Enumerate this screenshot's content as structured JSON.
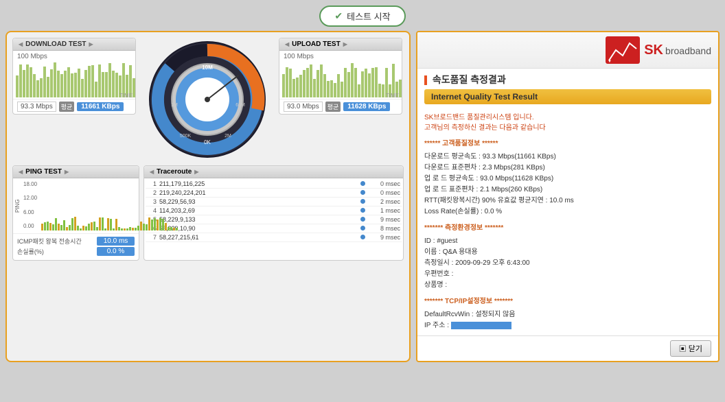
{
  "topButton": {
    "label": "테스트 시작"
  },
  "downloadTest": {
    "sectionLabel": "DOWNLOAD TEST",
    "speedMax": "100 Mbps",
    "timeLabel": "TIME",
    "resultSpeed": "93.3 Mbps",
    "avgLabel": "평균",
    "kbpsValue": "11661 KBps"
  },
  "uploadTest": {
    "sectionLabel": "UPLOAD TEST",
    "speedMax": "100 Mbps",
    "timeLabel": "TIME",
    "resultSpeed": "93.0 Mbps",
    "avgLabel": "평균",
    "kbpsValue": "11628 KBps"
  },
  "pingTest": {
    "sectionLabel": "PING TEST",
    "yLabels": [
      "18.00",
      "12.00",
      "6.00",
      "0.00"
    ],
    "pingLabel": "PING",
    "rttLabel": "ICMP패킷 왕복 전송시간",
    "rttValue": "10.0 ms",
    "lossLabel": "손실률(%)",
    "lossValue": "0.0 %"
  },
  "traceroute": {
    "sectionLabel": "Traceroute",
    "rows": [
      {
        "num": "1",
        "ip": "211,179,116,225",
        "time": "0 msec"
      },
      {
        "num": "2",
        "ip": "219,240,224,201",
        "time": "0 msec"
      },
      {
        "num": "3",
        "ip": "58,229,56,93",
        "time": "2 msec"
      },
      {
        "num": "4",
        "ip": "114,203,2,69",
        "time": "1 msec"
      },
      {
        "num": "5",
        "ip": "58,229,9,133",
        "time": "9 msec"
      },
      {
        "num": "6",
        "ip": "58,229,10,90",
        "time": "8 msec"
      },
      {
        "num": "7",
        "ip": "58,227,215,61",
        "time": "9 msec"
      }
    ]
  },
  "rightPanel": {
    "brand": "SK broadband",
    "sk": "SK",
    "bb": "broadband",
    "sectionTitle": "속도품질 측정결과",
    "qualityLabel": "Internet Quality Test Result",
    "introLine1": "SK브로드밴드 품질관리시스템 입니다.",
    "introLine2": "고객님의 측정하신 결과는 다음과 같습니다",
    "customerTitle": "****** 고객품질정보 ******",
    "lines": [
      "다운로드 평균속도 : 93.3 Mbps(11661 KBps)",
      "다운로드 표준편차 : 2.3 Mbps(281 KBps)",
      "업 로 드 평균속도 : 93.0 Mbps(11628 KBps)",
      "업 로 드 표준편차 : 2.1 Mbps(260 KBps)",
      "RTT(패킷왕복시간) 90% 유효값 평균지연 : 10.0 ms",
      "Loss Rate(손실률) : 0.0 %"
    ],
    "envTitle": "******* 측정환경정보 *******",
    "envLines": [
      "ID : #guest",
      "이름 : Q&A 용대용",
      "측정일시 : 2009-09-29 오후 6:43:00",
      "우편번호 :",
      "상품명 :"
    ],
    "tcpTitle": "******* TCP/IP설정정보 *******",
    "tcpLines": [
      "DefaultRcvWin : 설정되지 않음",
      "IP 주소 :"
    ],
    "ipHidden": "■■■■■■■■",
    "closeBtn": "닫기"
  }
}
